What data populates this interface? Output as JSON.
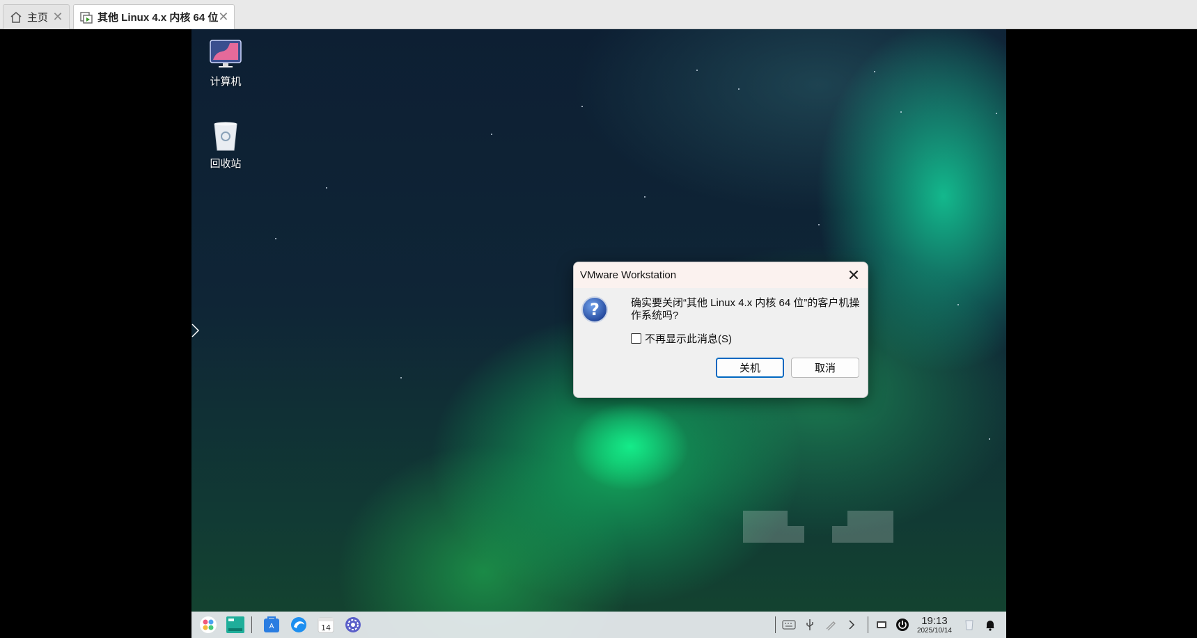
{
  "tabs": [
    {
      "label": "主页",
      "icon": "home-icon",
      "close": "✕"
    },
    {
      "label": "其他 Linux 4.x 内核 64 位",
      "icon": "vm-running-icon",
      "close": "✕"
    }
  ],
  "desktop": {
    "icons": [
      {
        "label": "计算机",
        "icon": "computer-icon"
      },
      {
        "label": "回收站",
        "icon": "recycle-bin-icon"
      }
    ]
  },
  "dialog": {
    "title": "VMware Workstation",
    "message": "确实要关闭“其他 Linux 4.x 内核 64 位”的客户机操作系统吗?",
    "checkbox_label": "不再显示此消息(S)",
    "checkbox_checked": false,
    "confirm_label": "关机",
    "cancel_label": "取消"
  },
  "taskbar": {
    "apps": [
      "launcher-icon",
      "file-manager-icon",
      "app-store-icon",
      "browser-icon",
      "calendar-icon",
      "settings-icon"
    ],
    "calendar_day": "14",
    "tray": [
      "keyboard-icon",
      "usb-icon",
      "pen-icon",
      "chevron-right-icon",
      "input-method-icon",
      "power-icon"
    ],
    "clock": {
      "time": "19:13",
      "date": "2025/10/14"
    }
  },
  "colors": {
    "accent": "#0067c0",
    "title_bar": "#fbf2ef",
    "dialog_bg": "#f0f0f0"
  }
}
